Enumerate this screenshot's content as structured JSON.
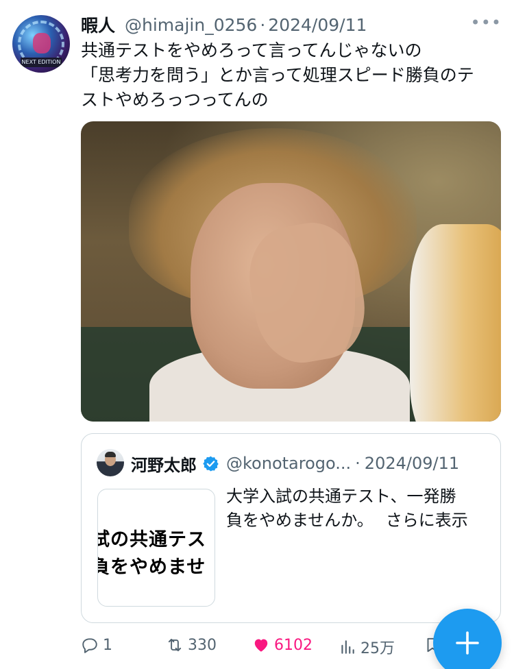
{
  "tweet": {
    "author_name": "暇人",
    "author_handle": "@himajin_0256",
    "separator": "·",
    "date": "2024/09/11",
    "more": "•••",
    "avatar_text": "NEXT EDITION",
    "lines": [
      "共通テストをやめろって言ってんじゃないの",
      "「思考力を問う」とか言って処理スピード勝負のテ",
      "ストやめろっつってんの"
    ]
  },
  "quote": {
    "author_name": "河野太郎",
    "author_handle": "@konotarogo...",
    "separator": "·",
    "date": "2024/09/11",
    "thumb_line1": "試の共通テス",
    "thumb_line2": "負をやめませ",
    "text_line1": "大学入試の共通テスト、一発勝",
    "text_line2": "負をやめませんか。",
    "show_more": "さらに表示",
    "verified_color": "#1d9bf0"
  },
  "actions": {
    "replies": "1",
    "retweets": "330",
    "likes": "6102",
    "views": "25万"
  },
  "colors": {
    "accent": "#1d9bf0",
    "like": "#f91880",
    "secondary_text": "#536471"
  },
  "icons": {
    "reply": "reply-icon",
    "retweet": "retweet-icon",
    "like": "heart-icon",
    "views": "views-icon",
    "bookmark": "bookmark-icon",
    "compose": "plus-icon"
  }
}
